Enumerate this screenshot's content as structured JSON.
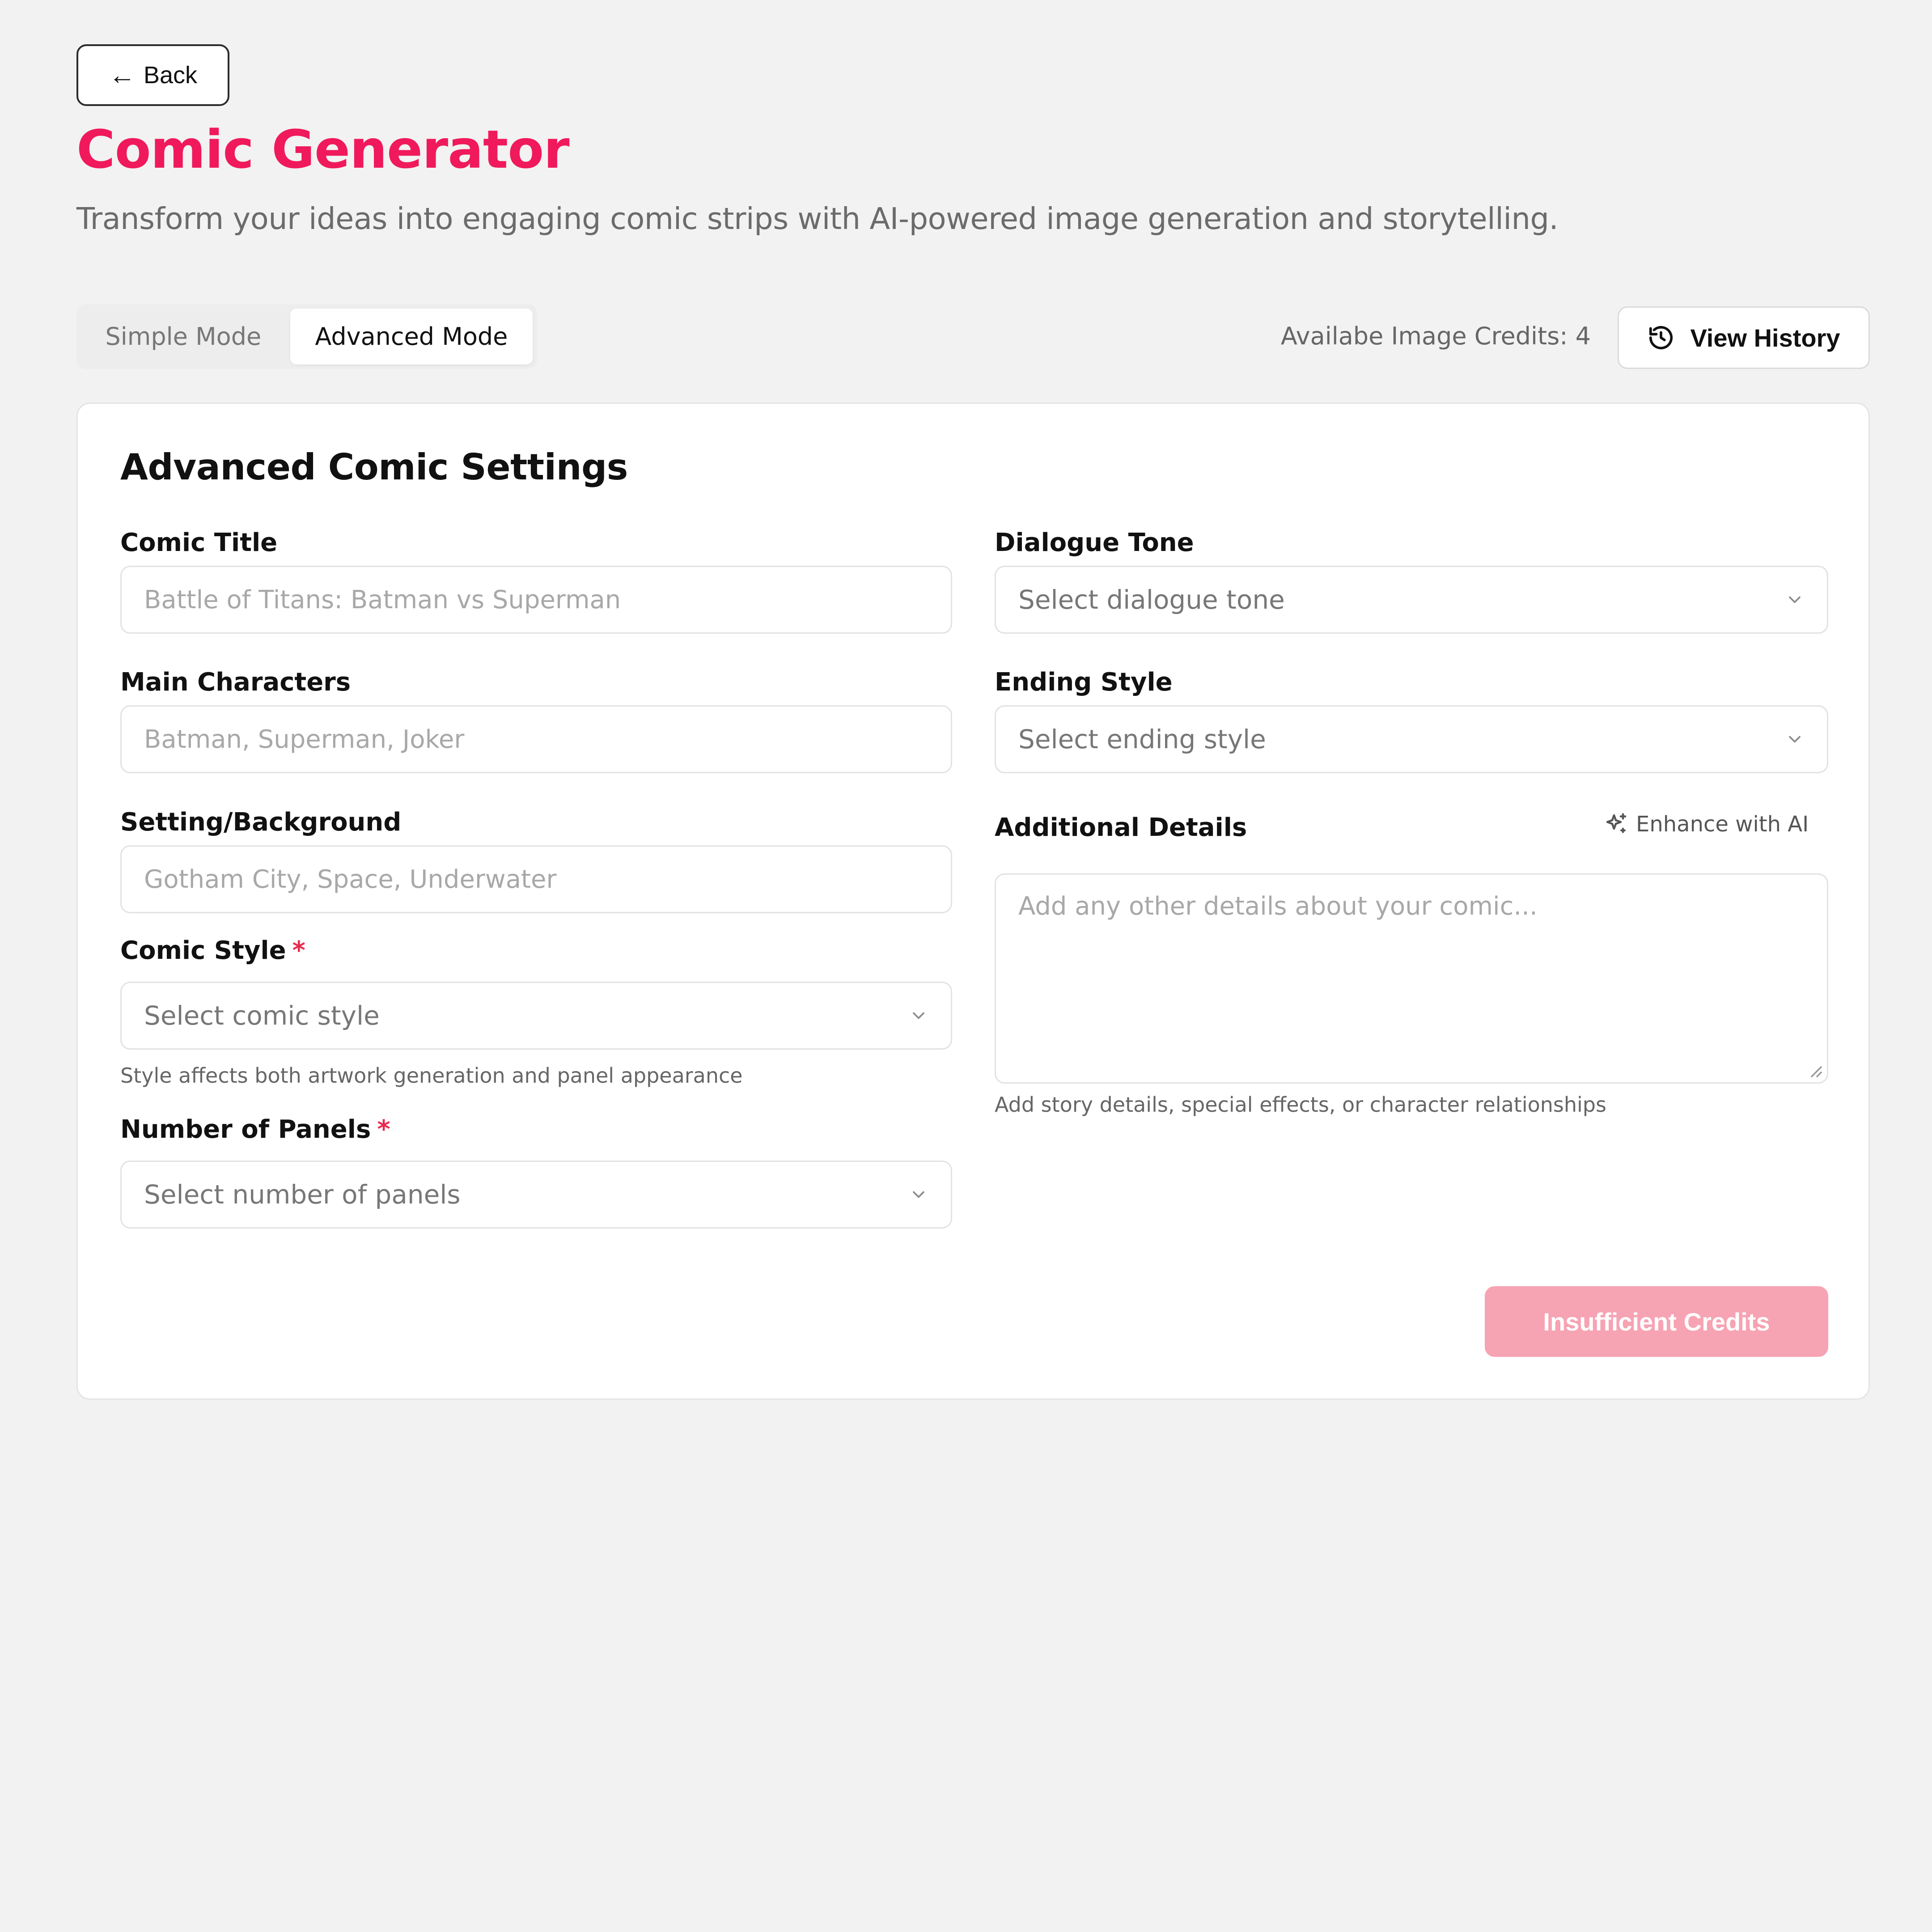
{
  "header": {
    "back_label": "Back",
    "title": "Comic Generator",
    "subtitle": "Transform your ideas into engaging comic strips with AI-powered image generation and storytelling."
  },
  "modes": {
    "tabs": [
      {
        "label": "Simple Mode",
        "active": false
      },
      {
        "label": "Advanced Mode",
        "active": true
      }
    ]
  },
  "credits": {
    "label": "Availabe Image Credits: 4"
  },
  "history": {
    "label": "View History"
  },
  "form": {
    "title": "Advanced Comic Settings",
    "comic_title": {
      "label": "Comic Title",
      "placeholder": "Battle of Titans: Batman vs Superman"
    },
    "main_characters": {
      "label": "Main Characters",
      "placeholder": "Batman, Superman, Joker"
    },
    "setting": {
      "label": "Setting/Background",
      "placeholder": "Gotham City, Space, Underwater"
    },
    "comic_style": {
      "label": "Comic Style",
      "required_mark": "*",
      "placeholder": "Select comic style",
      "hint": "Style affects both artwork generation and panel appearance"
    },
    "panels": {
      "label": "Number of Panels",
      "required_mark": "*",
      "placeholder": "Select number of panels"
    },
    "dialogue_tone": {
      "label": "Dialogue Tone",
      "placeholder": "Select dialogue tone"
    },
    "ending_style": {
      "label": "Ending Style",
      "placeholder": "Select ending style"
    },
    "additional_details": {
      "label": "Additional Details",
      "enhance_label": "Enhance with AI",
      "placeholder": "Add any other details about your comic...",
      "hint": "Add story details, special effects, or character relationships"
    },
    "submit_label": "Insufficient Credits"
  },
  "colors": {
    "accent": "#f0195c",
    "submit_disabled": "#f6a3b3",
    "background": "#f2f2f2"
  },
  "icons": {
    "back": "arrow-left-icon",
    "history": "history-icon",
    "chevron": "chevron-down-icon",
    "enhance": "sparkles-icon"
  }
}
